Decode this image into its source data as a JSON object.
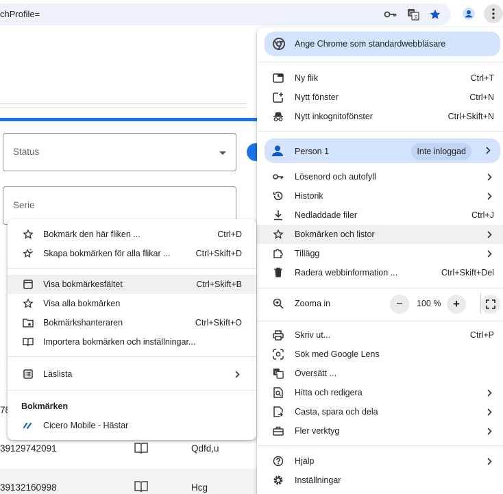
{
  "toolbar": {
    "url_text": "chProfile=",
    "icons": [
      "password-key-icon",
      "translate-icon",
      "bookmark-star-filled-icon",
      "profile-icon",
      "more-vert-icon"
    ]
  },
  "background": {
    "status_label": "Status",
    "serie_label": "Serie",
    "rows": [
      {
        "id": "78",
        "name": ""
      },
      {
        "id": "39129742091",
        "name": "Qdfd,u"
      },
      {
        "id": "39132160998",
        "name": "Hcg"
      }
    ]
  },
  "main_menu": {
    "default_browser": "Ange Chrome som standardwebbläsare",
    "new_tab": {
      "label": "Ny flik",
      "shortcut": "Ctrl+T"
    },
    "new_window": {
      "label": "Nytt fönster",
      "shortcut": "Ctrl+N"
    },
    "incognito": {
      "label": "Nytt inkognitofönster",
      "shortcut": "Ctrl+Skift+N"
    },
    "profile": {
      "label": "Person 1",
      "badge": "Inte inloggad"
    },
    "passwords": {
      "label": "Lösenord och autofyll"
    },
    "history": {
      "label": "Historik"
    },
    "downloads": {
      "label": "Nedladdade filer",
      "shortcut": "Ctrl+J"
    },
    "bookmarks": {
      "label": "Bokmärken och listor"
    },
    "extensions": {
      "label": "Tillägg"
    },
    "clear_data": {
      "label": "Radera webbinformation ...",
      "shortcut": "Ctrl+Skift+Del"
    },
    "zoom": {
      "label": "Zooma in",
      "minus": "−",
      "value": "100 %",
      "plus": "+"
    },
    "print": {
      "label": "Skriv ut...",
      "shortcut": "Ctrl+P"
    },
    "lens": {
      "label": "Sök med Google Lens"
    },
    "translate": {
      "label": "Översätt ..."
    },
    "find": {
      "label": "Hitta och redigera"
    },
    "cast": {
      "label": "Casta, spara och dela"
    },
    "more_tools": {
      "label": "Fler verktyg"
    },
    "help": {
      "label": "Hjälp"
    },
    "settings": {
      "label": "Inställningar"
    }
  },
  "bookmarks_submenu": {
    "bookmark_tab": {
      "label": "Bokmärk den här fliken ...",
      "shortcut": "Ctrl+D"
    },
    "bookmark_all": {
      "label": "Skapa bokmärken för alla flikar ...",
      "shortcut": "Ctrl+Skift+D"
    },
    "show_bar": {
      "label": "Visa bokmärkesfältet",
      "shortcut": "Ctrl+Skift+B"
    },
    "show_all": {
      "label": "Visa alla bokmärken"
    },
    "manager": {
      "label": "Bokmärkshanteraren",
      "shortcut": "Ctrl+Skift+O"
    },
    "import": {
      "label": "Importera bokmärken och inställningar..."
    },
    "reading_list": {
      "label": "Läslista"
    },
    "section_title": "Bokmärken",
    "items": [
      {
        "label": "Cicero Mobile - Hästar"
      }
    ]
  },
  "colors": {
    "accent": "#1a73e8",
    "highlight": "#d3e3fd",
    "star": "#0b57d0"
  }
}
